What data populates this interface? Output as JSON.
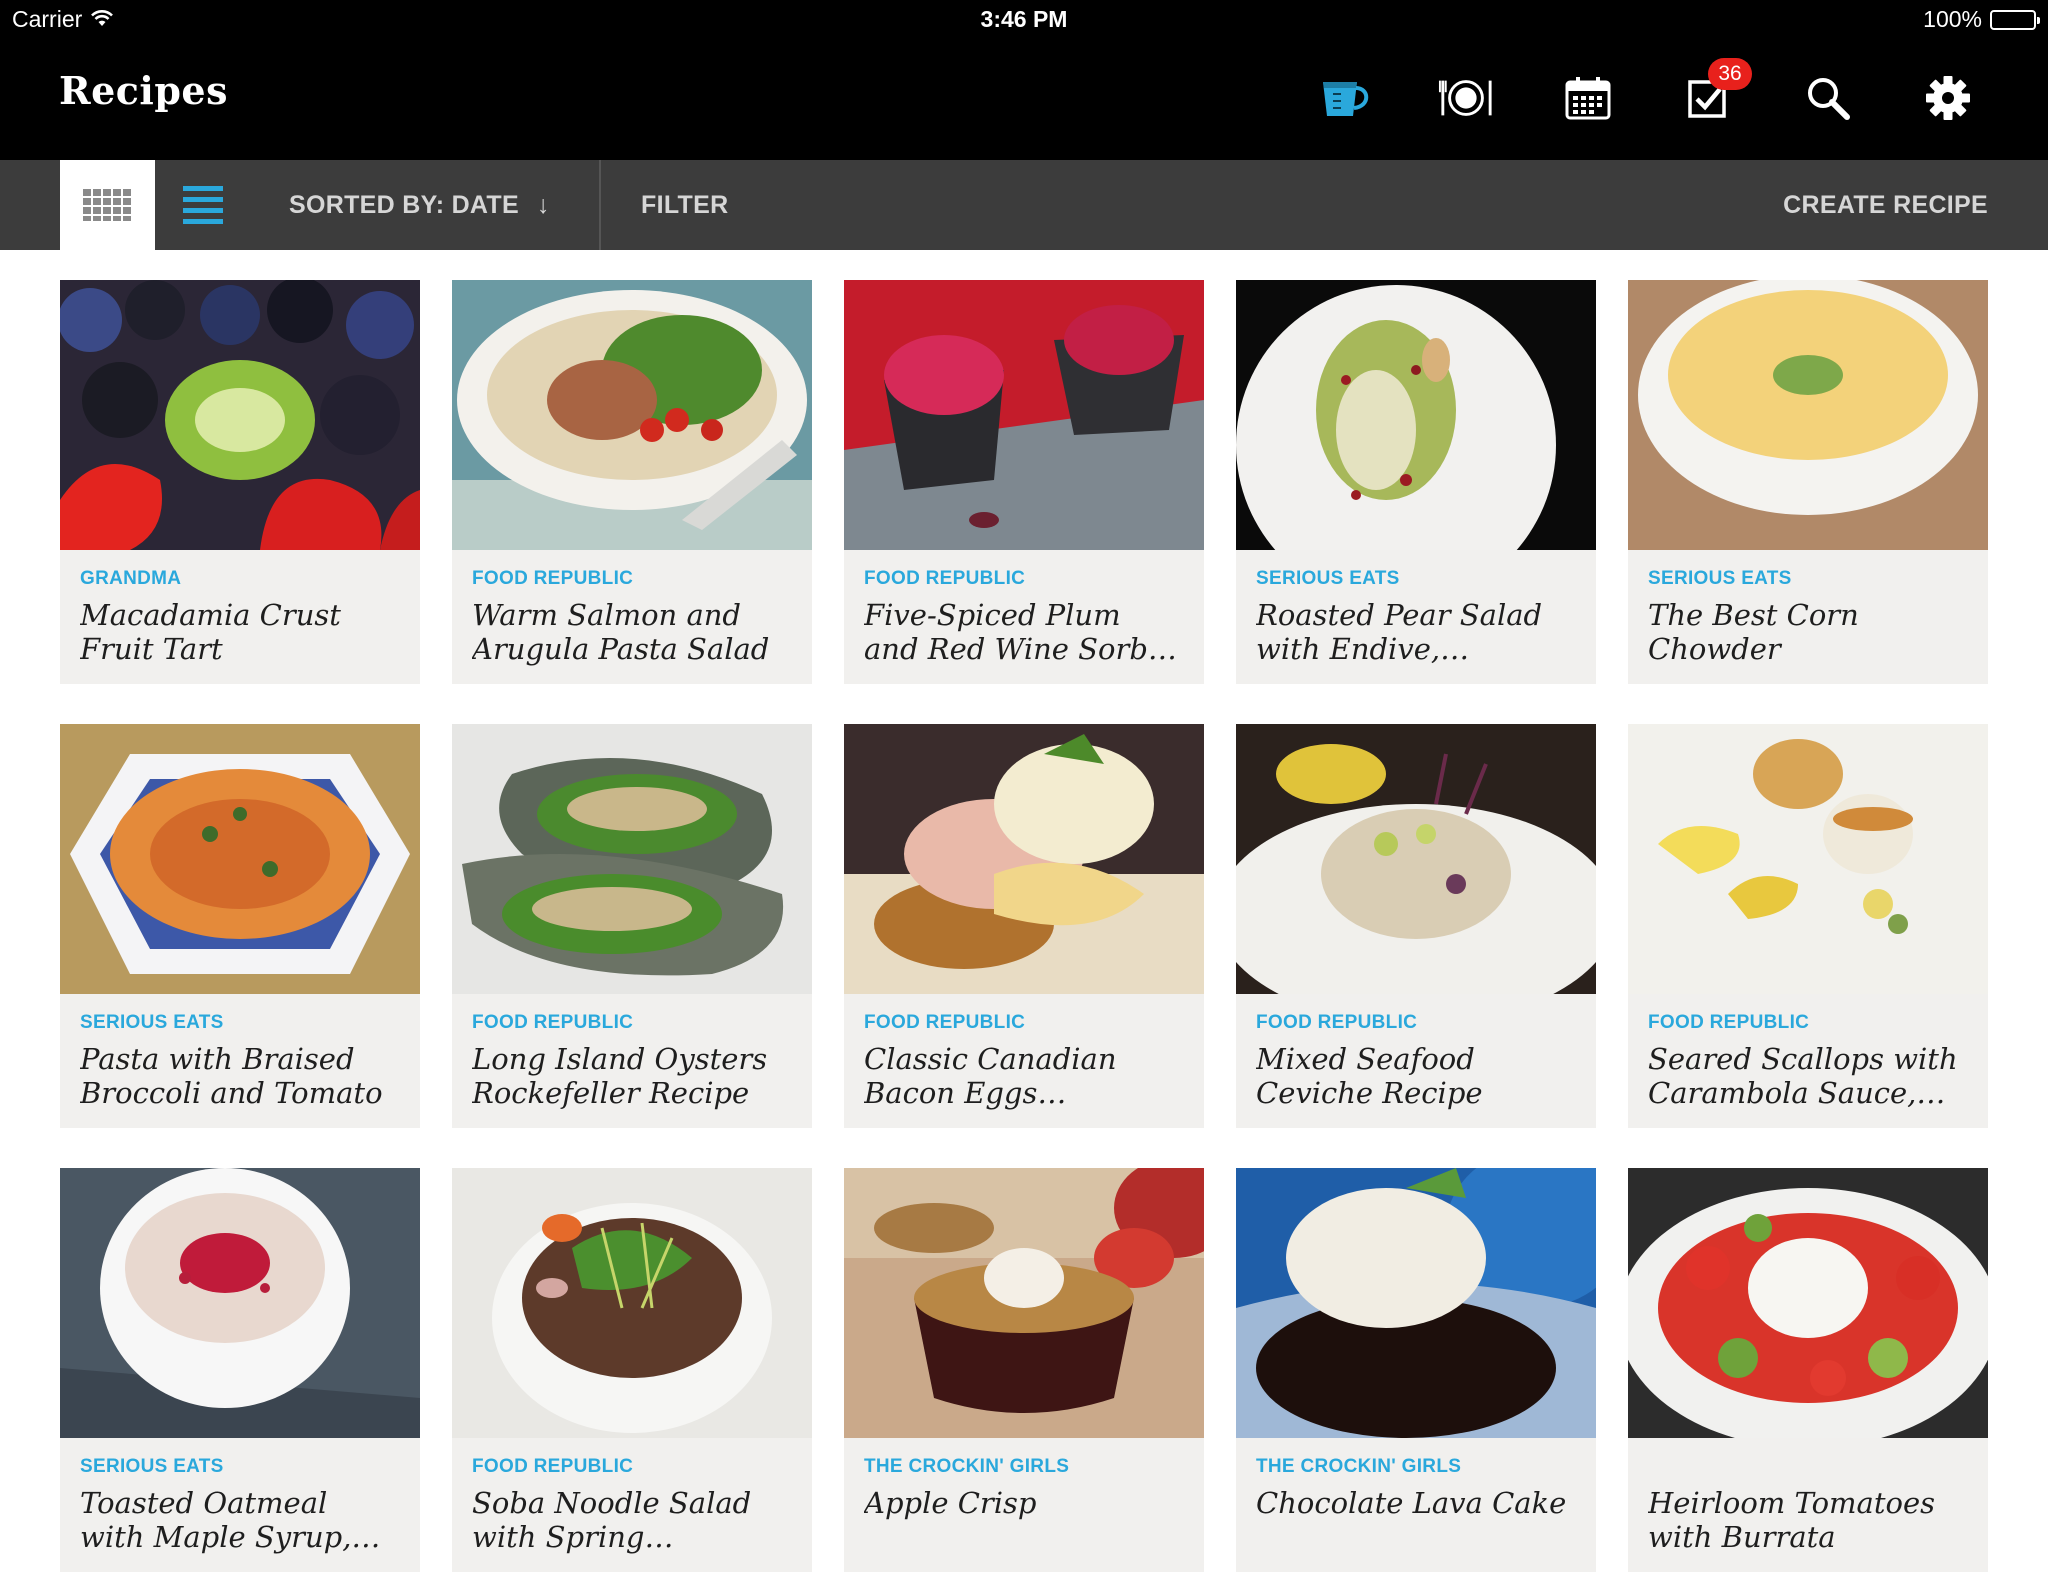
{
  "status_bar": {
    "carrier": "Carrier",
    "time": "3:46 PM",
    "battery": "100%"
  },
  "nav": {
    "title": "Recipes",
    "icons": [
      "measuring-cup-icon",
      "plate-icon",
      "calendar-icon",
      "checklist-icon",
      "search-icon",
      "gear-icon"
    ],
    "checklist_badge": "36",
    "accent_color": "#2aa8dc",
    "badge_color": "#e8211c"
  },
  "toolbar": {
    "sort_label": "SORTED BY: DATE",
    "sort_arrow": "↓",
    "filter_label": "FILTER",
    "create_label": "CREATE RECIPE"
  },
  "recipes": [
    {
      "source": "GRANDMA",
      "title": "Macadamia Crust Fruit Tart"
    },
    {
      "source": "FOOD REPUBLIC",
      "title": "Warm Salmon and Arugula Pasta Salad"
    },
    {
      "source": "FOOD REPUBLIC",
      "title": "Five-Spiced Plum and Red Wine Sorbet Reci..."
    },
    {
      "source": "SERIOUS EATS",
      "title": "Roasted Pear Salad with Endive, Pomegr..."
    },
    {
      "source": "SERIOUS EATS",
      "title": "The Best Corn Chowder"
    },
    {
      "source": "SERIOUS EATS",
      "title": "Pasta with Braised Broccoli and Tomato"
    },
    {
      "source": "FOOD REPUBLIC",
      "title": "Long Island Oysters Rockefeller Recipe"
    },
    {
      "source": "FOOD REPUBLIC",
      "title": "Classic Canadian Bacon Eggs Benedict..."
    },
    {
      "source": "FOOD REPUBLIC",
      "title": "Mixed Seafood Ceviche Recipe"
    },
    {
      "source": "FOOD REPUBLIC",
      "title": "Seared Scallops with Carambola Sauce, Pa..."
    },
    {
      "source": "SERIOUS EATS",
      "title": "Toasted Oatmeal with Maple Syrup, Cranbe..."
    },
    {
      "source": "FOOD REPUBLIC",
      "title": "Soba Noodle Salad with Spring Vegetables"
    },
    {
      "source": "THE CROCKIN' GIRLS",
      "title": "Apple Crisp"
    },
    {
      "source": "THE CROCKIN' GIRLS",
      "title": "Chocolate Lava Cake"
    },
    {
      "source": "",
      "title": "Heirloom Tomatoes with Burrata"
    }
  ]
}
